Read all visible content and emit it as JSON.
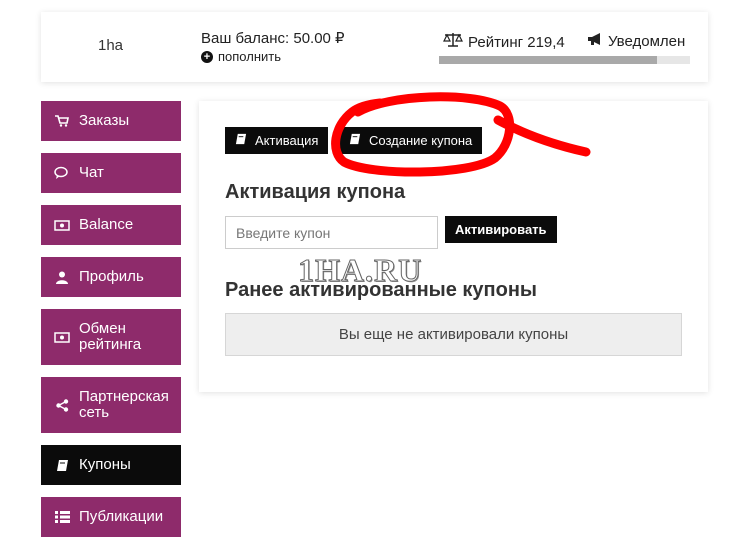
{
  "header": {
    "username": "1ha",
    "balance_text": "Ваш баланс: 50.00 ₽",
    "topup_label": "пополнить",
    "rating_label": "Рейтинг 219,4",
    "notifications_label": "Уведомлен",
    "rating_progress": 0.87
  },
  "sidebar": {
    "items": [
      {
        "label": "Заказы",
        "icon": "cart-icon"
      },
      {
        "label": "Чат",
        "icon": "chat-icon"
      },
      {
        "label": "Balance",
        "icon": "money-icon"
      },
      {
        "label": "Профиль",
        "icon": "user-icon"
      },
      {
        "label": "Обмен рейтинга",
        "icon": "money-icon"
      },
      {
        "label": "Партнерская сеть",
        "icon": "share-icon"
      },
      {
        "label": "Купоны",
        "icon": "book-icon",
        "active": true
      },
      {
        "label": "Публикации",
        "icon": "list-icon"
      }
    ]
  },
  "main": {
    "tabs": [
      {
        "label": "Активация",
        "icon": "book-icon"
      },
      {
        "label": "Создание купона",
        "icon": "book-icon"
      }
    ],
    "activation_title": "Активация купона",
    "coupon_placeholder": "Введите купон",
    "activate_button": "Активировать",
    "history_title": "Ранее активированные купоны",
    "empty_message": "Вы еще не активировали купоны"
  },
  "watermark": "1HA.RU",
  "colors": {
    "sidebar_bg": "#8e2b6b",
    "active_bg": "#0b0b0b",
    "annotation": "#ff0000"
  }
}
